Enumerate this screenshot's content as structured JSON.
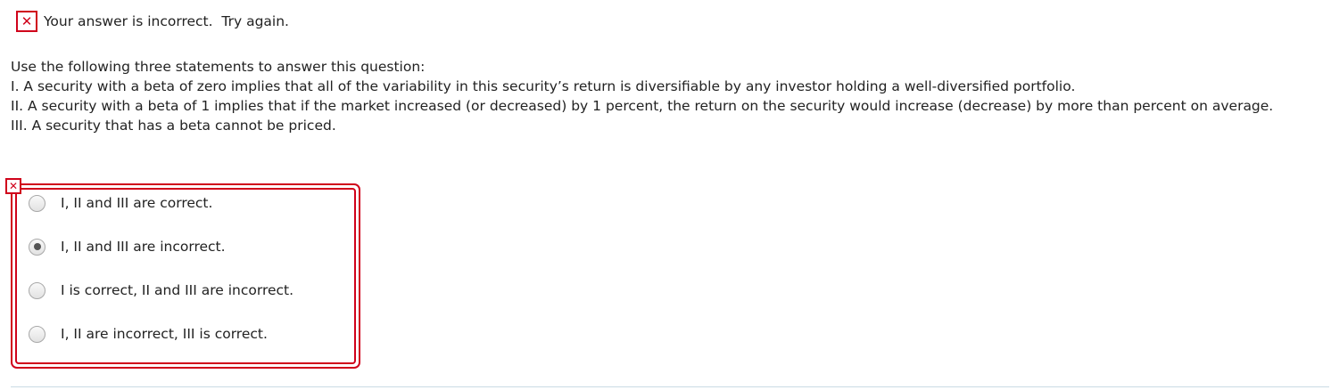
{
  "feedback": {
    "icon": "close-icon",
    "status_color": "#d0021b",
    "message": "Your answer is incorrect.  Try again."
  },
  "question": {
    "intro": "Use the following three statements to answer this question:",
    "statements": [
      "I. A security with a beta of zero implies that all of the variability in this security’s return is diversifiable by any investor holding a well-diversified portfolio.",
      "II. A security with a beta of 1 implies that if the market increased (or decreased) by 1 percent, the return on the security would increase (decrease) by more than percent on average.",
      "III. A security that has a beta cannot be priced."
    ]
  },
  "answers": {
    "status_icon": "close-icon",
    "selected_index": 1,
    "options": [
      {
        "label": "I, II and III are correct."
      },
      {
        "label": "I, II and III are incorrect."
      },
      {
        "label": "I is correct, II and III are incorrect."
      },
      {
        "label": "I, II are incorrect, III is correct."
      }
    ]
  }
}
